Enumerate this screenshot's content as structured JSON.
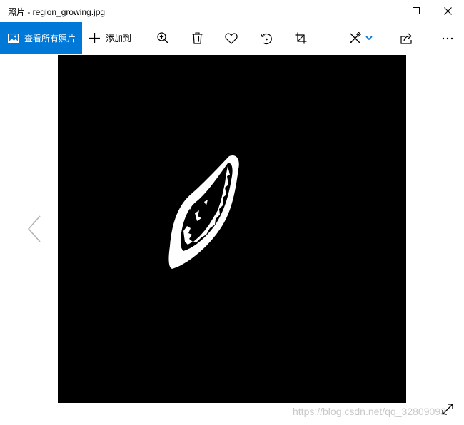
{
  "window": {
    "title": "照片 - region_growing.jpg"
  },
  "titlebar_controls": [
    "minimize-icon",
    "maximize-icon",
    "close-icon"
  ],
  "toolbar": {
    "view_all_label": "查看所有照片",
    "add_to_label": "添加到",
    "icons": [
      "zoom-in-icon",
      "delete-icon",
      "favorite-icon",
      "rotate-icon",
      "crop-icon",
      "edit-create-icon",
      "share-icon",
      "more-icon"
    ]
  },
  "colors": {
    "accent": "#0078d7",
    "image_background": "#000000",
    "foreground_shape": "#ffffff"
  },
  "viewer": {
    "image_file": "region_growing.jpg"
  },
  "watermark": "https://blog.csdn.net/qq_32809093"
}
